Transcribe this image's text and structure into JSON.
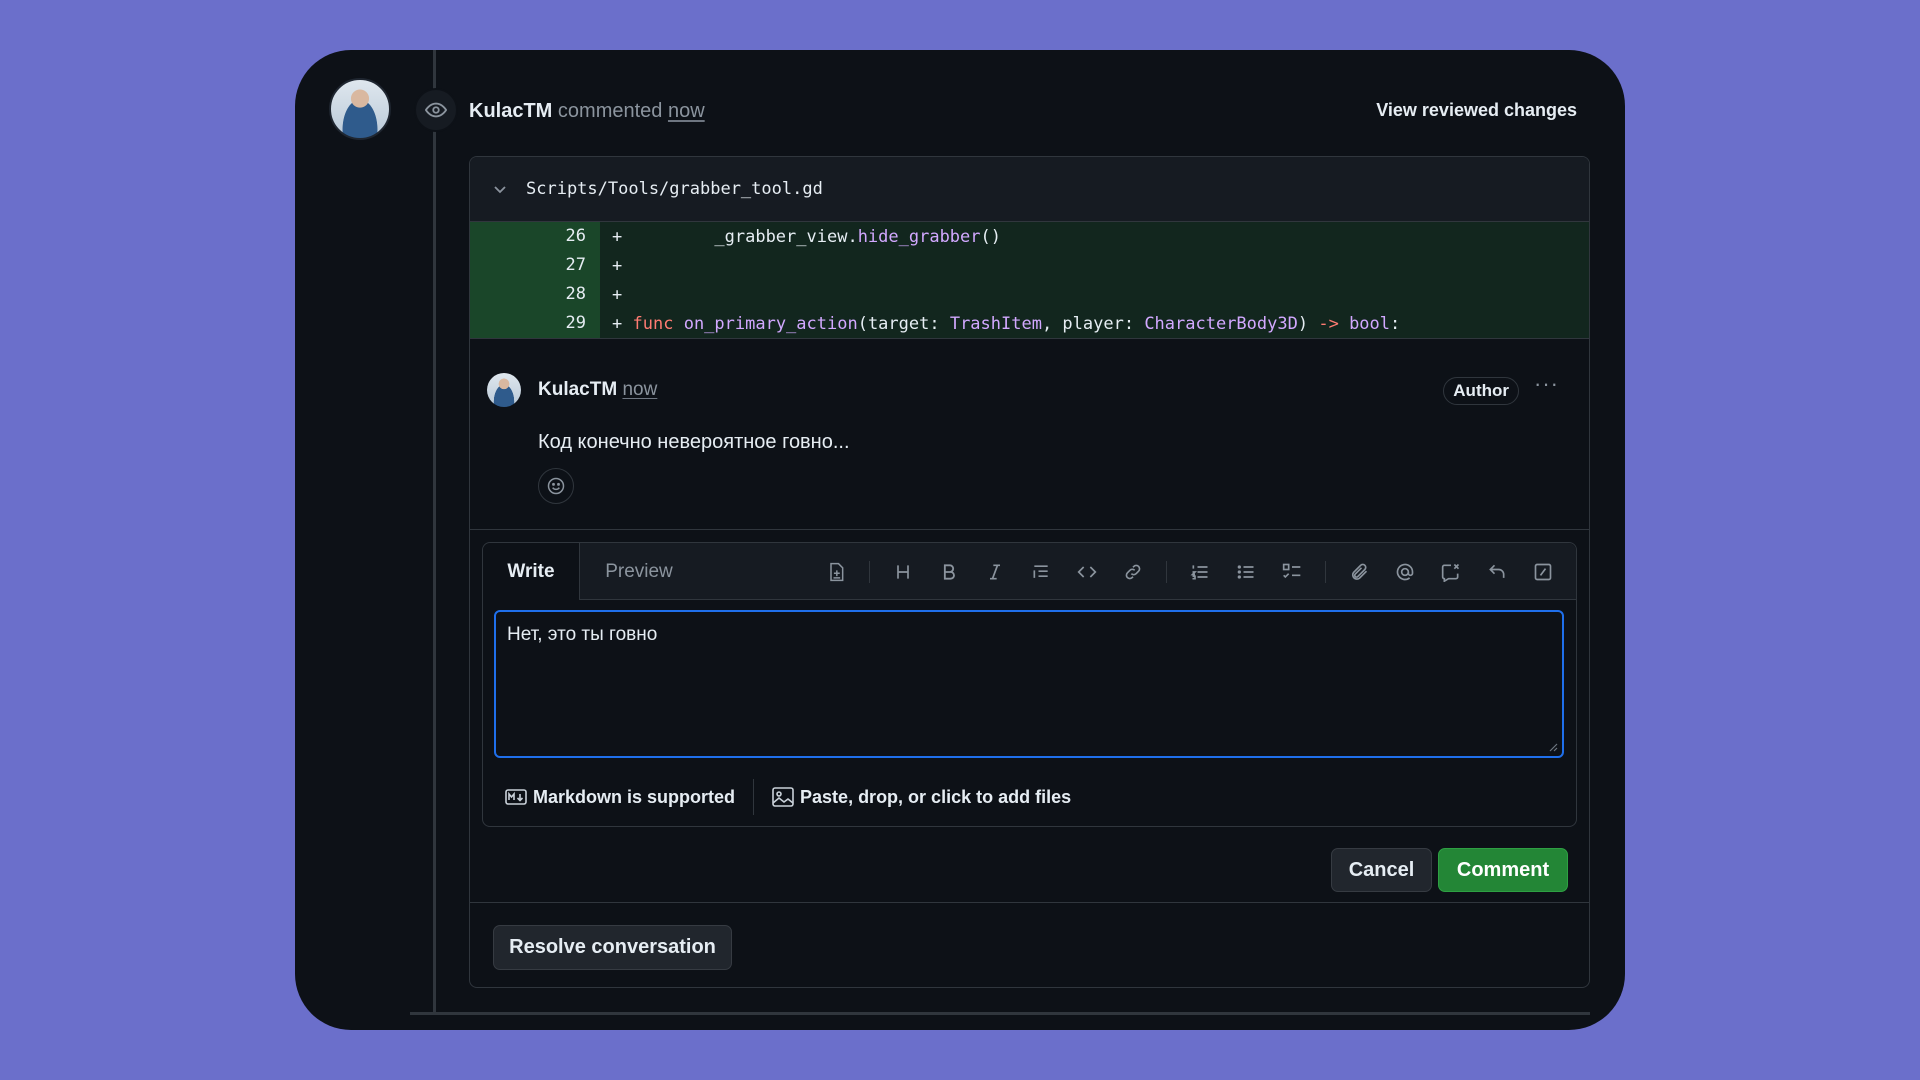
{
  "header": {
    "author": "KulacTM",
    "action": "commented",
    "time": "now",
    "view_changes": "View reviewed changes"
  },
  "file": {
    "path": "Scripts/Tools/grabber_tool.gd"
  },
  "diff": {
    "lines": [
      {
        "num": "26",
        "sign": "+"
      },
      {
        "num": "27",
        "sign": "+"
      },
      {
        "num": "28",
        "sign": "+"
      },
      {
        "num": "29",
        "sign": "+"
      }
    ],
    "line26": {
      "indent": "        ",
      "obj": "_grabber_view.",
      "call": "hide_grabber",
      "tail": "()"
    },
    "line29": {
      "kw": "func",
      "name": "on_primary_action",
      "p1": "(target: ",
      "t1": "TrashItem",
      "p2": ", player: ",
      "t2": "CharacterBody3D",
      "p3": ") ",
      "arrow": "->",
      "p4": " ",
      "t3": "bool",
      "p5": ":"
    }
  },
  "comment": {
    "author": "KulacTM",
    "time": "now",
    "badge": "Author",
    "more": "···",
    "body": "Код конечно невероятное говно..."
  },
  "editor": {
    "tab_write": "Write",
    "tab_preview": "Preview",
    "value": "Нет, это ты говно",
    "markdown_note": "Markdown is supported",
    "files_note": "Paste, drop, or click to add files",
    "toolbar_icons": [
      "add-file-icon",
      "heading-icon",
      "bold-icon",
      "italic-icon",
      "quote-icon",
      "code-icon",
      "link-icon",
      "ordered-list-icon",
      "unordered-list-icon",
      "task-list-icon",
      "attach-icon",
      "mention-icon",
      "cross-reference-icon",
      "reply-icon",
      "slash-command-icon"
    ]
  },
  "buttons": {
    "cancel": "Cancel",
    "comment": "Comment",
    "resolve": "Resolve conversation"
  },
  "colors": {
    "background": "#6b6fcb",
    "card": "#0d1117",
    "accent_blue": "#1f6feb",
    "comment_green": "#238636",
    "diff_added": "#12261e"
  }
}
